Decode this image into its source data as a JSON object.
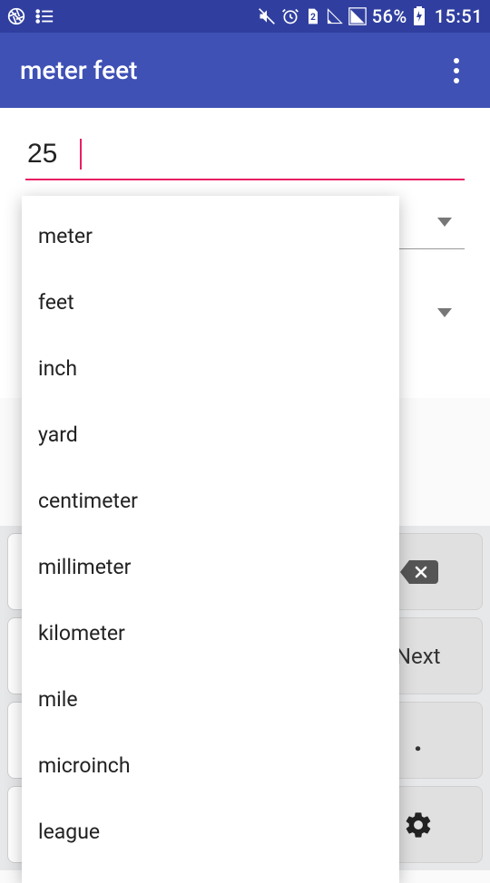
{
  "statusbar": {
    "battery_pct": "56%",
    "time": "15:51"
  },
  "appbar": {
    "title": "meter feet"
  },
  "input": {
    "value": "25"
  },
  "dropdown": {
    "items": [
      "meter",
      "feet",
      "inch",
      "yard",
      "centimeter",
      "millimeter",
      "kilometer",
      "mile",
      "microinch",
      "league"
    ]
  },
  "keyboard": {
    "next": "Next",
    "dot": "."
  }
}
